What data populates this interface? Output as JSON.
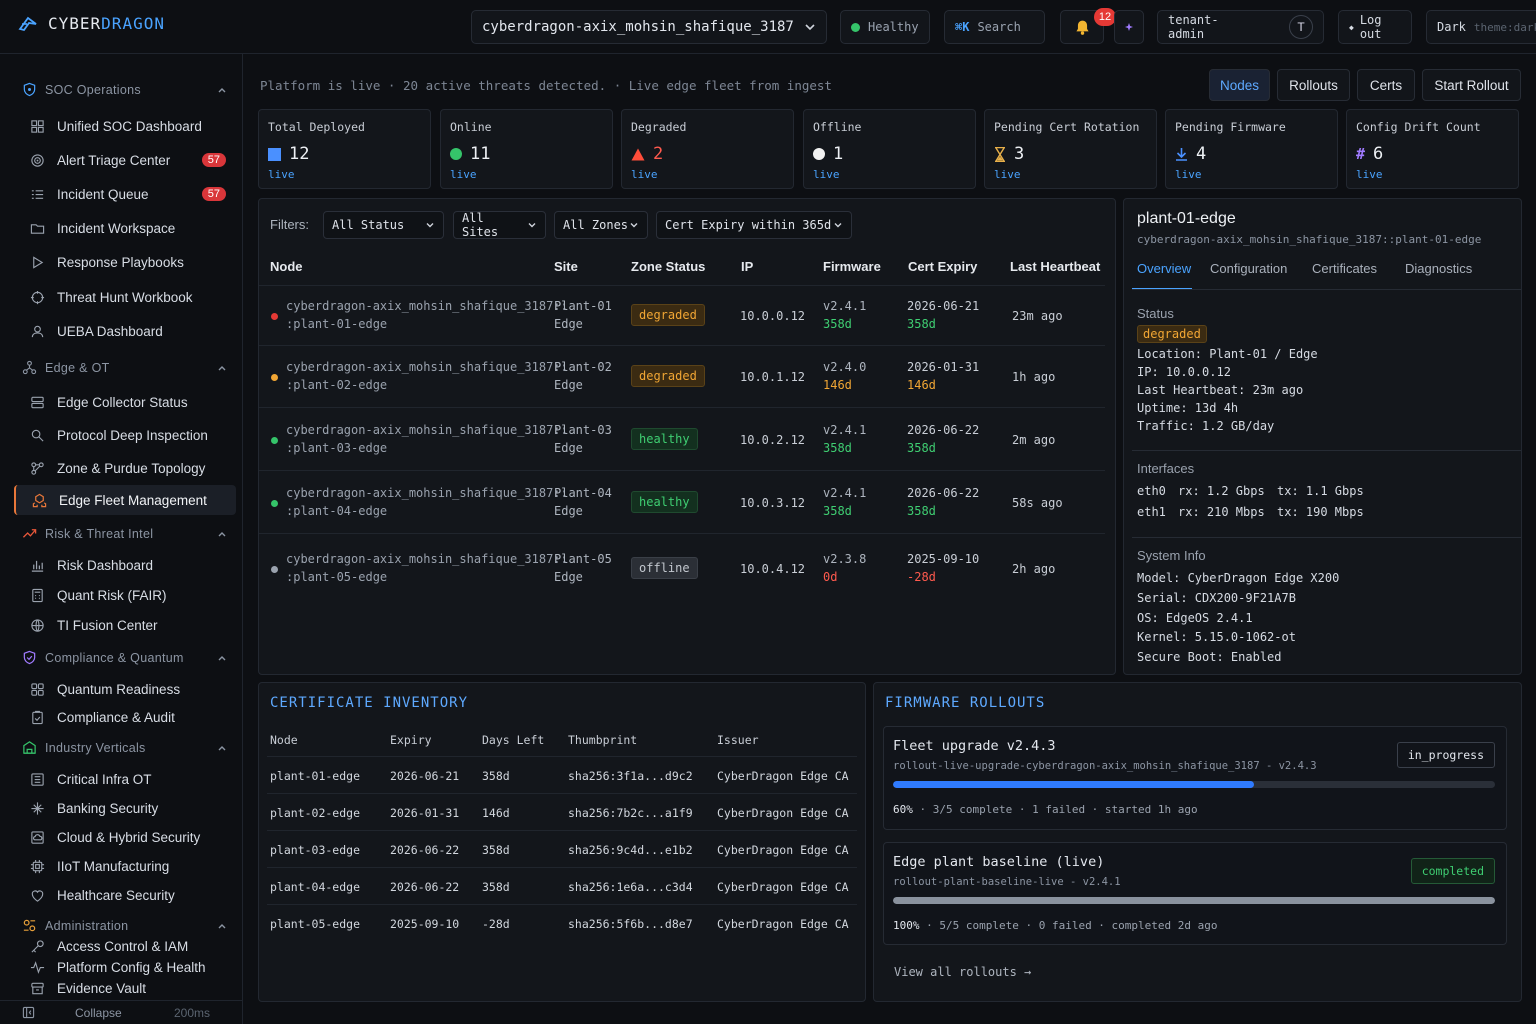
{
  "app": {
    "name_a": "CYBER",
    "name_b": "DRAGON"
  },
  "topbar": {
    "tenant": "cyberdragon-axix_mohsin_shafique_3187",
    "health": "Healthy",
    "search_key": "⌘K",
    "search_label": "Search",
    "notifications": "12",
    "user_line1": "tenant-",
    "user_line2": "admin",
    "avatar": "T",
    "logout": "Log out",
    "theme": "Dark",
    "theme_hint": "theme:dark"
  },
  "sidebar": {
    "sections": [
      {
        "label": "SOC Operations",
        "items": [
          {
            "label": "Unified SOC Dashboard"
          },
          {
            "label": "Alert Triage Center",
            "badge": "57"
          },
          {
            "label": "Incident Queue",
            "badge": "57"
          },
          {
            "label": "Incident Workspace"
          },
          {
            "label": "Response Playbooks"
          },
          {
            "label": "Threat Hunt Workbook"
          },
          {
            "label": "UEBA Dashboard"
          }
        ]
      },
      {
        "label": "Edge & OT",
        "items": [
          {
            "label": "Edge Collector Status"
          },
          {
            "label": "Protocol Deep Inspection"
          },
          {
            "label": "Zone & Purdue Topology"
          },
          {
            "label": "Edge Fleet Management"
          }
        ]
      },
      {
        "label": "Risk & Threat Intel",
        "items": [
          {
            "label": "Risk Dashboard"
          },
          {
            "label": "Quant Risk (FAIR)"
          },
          {
            "label": "TI Fusion Center"
          }
        ]
      },
      {
        "label": "Compliance & Quantum",
        "items": [
          {
            "label": "Quantum Readiness"
          },
          {
            "label": "Compliance & Audit"
          }
        ]
      },
      {
        "label": "Industry Verticals",
        "items": [
          {
            "label": "Critical Infra OT"
          },
          {
            "label": "Banking Security"
          },
          {
            "label": "Cloud & Hybrid Security"
          },
          {
            "label": "IIoT Manufacturing"
          },
          {
            "label": "Healthcare Security"
          }
        ]
      },
      {
        "label": "Administration",
        "items": [
          {
            "label": "Access Control & IAM"
          },
          {
            "label": "Platform Config & Health"
          },
          {
            "label": "Evidence Vault"
          }
        ]
      }
    ],
    "collapse": "Collapse",
    "latency": "200ms"
  },
  "main": {
    "notice": "Platform is live · 20 active threats detected. · Live edge fleet from ingest",
    "nav": [
      "Nodes",
      "Rollouts",
      "Certs",
      "Start Rollout"
    ],
    "kpis": [
      {
        "label": "Total Deployed",
        "value": "12",
        "sub": "live",
        "icon": "square",
        "color": "#4a90ff"
      },
      {
        "label": "Online",
        "value": "11",
        "sub": "live",
        "icon": "circle",
        "color": "#35c46a"
      },
      {
        "label": "Degraded",
        "value": "2",
        "sub": "live",
        "icon": "triangle",
        "color": "#ff4d3a"
      },
      {
        "label": "Offline",
        "value": "1",
        "sub": "live",
        "icon": "circle",
        "color": "#f2f2f2"
      },
      {
        "label": "Pending Cert Rotation",
        "value": "3",
        "sub": "live",
        "icon": "hourglass",
        "color": "#e8b04a"
      },
      {
        "label": "Pending Firmware",
        "value": "4",
        "sub": "live",
        "icon": "download",
        "color": "#4a90ff"
      },
      {
        "label": "Config Drift Count",
        "value": "6",
        "sub": "live",
        "icon": "hash",
        "color": "#a07bff"
      }
    ]
  },
  "nodes": {
    "filters_label": "Filters:",
    "filters": [
      "All Status",
      "All Sites",
      "All Zones",
      "Cert Expiry within 365d"
    ],
    "columns": [
      "Node",
      "Site",
      "Zone Status",
      "IP",
      "Firmware",
      "Cert Expiry",
      "Last Heartbeat"
    ],
    "rows": [
      {
        "n1": "cyberdragon-axix_mohsin_shafique_3187::",
        "n2": ":plant-01-edge",
        "site1": "Plant-01",
        "site2": "Edge",
        "status": "degraded",
        "ip": "10.0.0.12",
        "fw": "v2.4.1",
        "fwd": "358d",
        "exp": "2026-06-21",
        "expd": "358d",
        "hb": "23m ago",
        "dot": "#e53935"
      },
      {
        "n1": "cyberdragon-axix_mohsin_shafique_3187::",
        "n2": ":plant-02-edge",
        "site1": "Plant-02",
        "site2": "Edge",
        "status": "degraded",
        "ip": "10.0.1.12",
        "fw": "v2.4.0",
        "fwd": "146d",
        "exp": "2026-01-31",
        "expd": "146d",
        "hb": "1h ago",
        "dot": "#f1a634"
      },
      {
        "n1": "cyberdragon-axix_mohsin_shafique_3187::",
        "n2": ":plant-03-edge",
        "site1": "Plant-03",
        "site2": "Edge",
        "status": "healthy",
        "ip": "10.0.2.12",
        "fw": "v2.4.1",
        "fwd": "358d",
        "exp": "2026-06-22",
        "expd": "358d",
        "hb": "2m ago",
        "dot": "#35c46a"
      },
      {
        "n1": "cyberdragon-axix_mohsin_shafique_3187::",
        "n2": ":plant-04-edge",
        "site1": "Plant-04",
        "site2": "Edge",
        "status": "healthy",
        "ip": "10.0.3.12",
        "fw": "v2.4.1",
        "fwd": "358d",
        "exp": "2026-06-22",
        "expd": "358d",
        "hb": "58s ago",
        "dot": "#35c46a"
      },
      {
        "n1": "cyberdragon-axix_mohsin_shafique_3187::",
        "n2": ":plant-05-edge",
        "site1": "Plant-05",
        "site2": "Edge",
        "status": "offline",
        "ip": "10.0.4.12",
        "fw": "v2.3.8",
        "fwd": "0d",
        "exp": "2025-09-10",
        "expd": "-28d",
        "hb": "2h ago",
        "dot": "#9aa2ae"
      }
    ]
  },
  "detail": {
    "title": "plant-01-edge",
    "subtitle": "cyberdragon-axix_mohsin_shafique_3187::plant-01-edge",
    "tabs": [
      "Overview",
      "Configuration",
      "Certificates",
      "Diagnostics"
    ],
    "status_label": "Status",
    "status": "degraded",
    "location": "Location: Plant-01 / Edge",
    "ip": "IP: 10.0.0.12",
    "heartbeat": "Last Heartbeat: 23m ago",
    "uptime": "Uptime: 13d 4h",
    "traffic": "Traffic: 1.2 GB/day",
    "interfaces_label": "Interfaces",
    "interfaces": [
      {
        "name": "eth0",
        "rx": "rx: 1.2 Gbps",
        "tx": "tx: 1.1 Gbps"
      },
      {
        "name": "eth1",
        "rx": "rx: 210 Mbps",
        "tx": "tx: 190 Mbps"
      }
    ],
    "sysinfo_label": "System Info",
    "model": "Model: CyberDragon Edge X200",
    "serial": "Serial: CDX200-9F21A7B",
    "os": "OS: EdgeOS 2.4.1",
    "kernel": "Kernel: 5.15.0-1062-ot",
    "secure_boot": "Secure Boot: Enabled"
  },
  "certs": {
    "title": "CERTIFICATE INVENTORY",
    "columns": [
      "Node",
      "Expiry",
      "Days Left",
      "Thumbprint",
      "Issuer"
    ],
    "rows": [
      {
        "node": "plant-01-edge",
        "exp": "2026-06-21",
        "days": "358d",
        "thumb": "sha256:3f1a...d9c2",
        "issuer": "CyberDragon Edge CA",
        "tone": "green"
      },
      {
        "node": "plant-02-edge",
        "exp": "2026-01-31",
        "days": "146d",
        "thumb": "sha256:7b2c...a1f9",
        "issuer": "CyberDragon Edge CA",
        "tone": "orange"
      },
      {
        "node": "plant-03-edge",
        "exp": "2026-06-22",
        "days": "358d",
        "thumb": "sha256:9c4d...e1b2",
        "issuer": "CyberDragon Edge CA",
        "tone": "green"
      },
      {
        "node": "plant-04-edge",
        "exp": "2026-06-22",
        "days": "358d",
        "thumb": "sha256:1e6a...c3d4",
        "issuer": "CyberDragon Edge CA",
        "tone": "green"
      },
      {
        "node": "plant-05-edge",
        "exp": "2025-09-10",
        "days": "-28d",
        "thumb": "sha256:5f6b...d8e7",
        "issuer": "CyberDragon Edge CA",
        "tone": "red"
      }
    ]
  },
  "rollouts": {
    "title": "FIRMWARE ROLLOUTS",
    "items": [
      {
        "name": "Fleet upgrade v2.4.3",
        "id": "rollout-live-upgrade-cyberdragon-axix_mohsin_shafique_3187 - v2.4.3",
        "status": "in_progress",
        "progress": 0.6,
        "pct": "60%",
        "meta": "· 3/5 complete · 1 failed · started 1h ago",
        "color": "#2f7bff"
      },
      {
        "name": "Edge plant baseline (live)",
        "id": "rollout-plant-baseline-live - v2.4.1",
        "status": "completed",
        "progress": 1.0,
        "pct": "100%",
        "meta": "· 5/5 complete · 0 failed · completed 2d ago",
        "color": "#8a929e"
      }
    ],
    "view_all": "View all rollouts →"
  }
}
